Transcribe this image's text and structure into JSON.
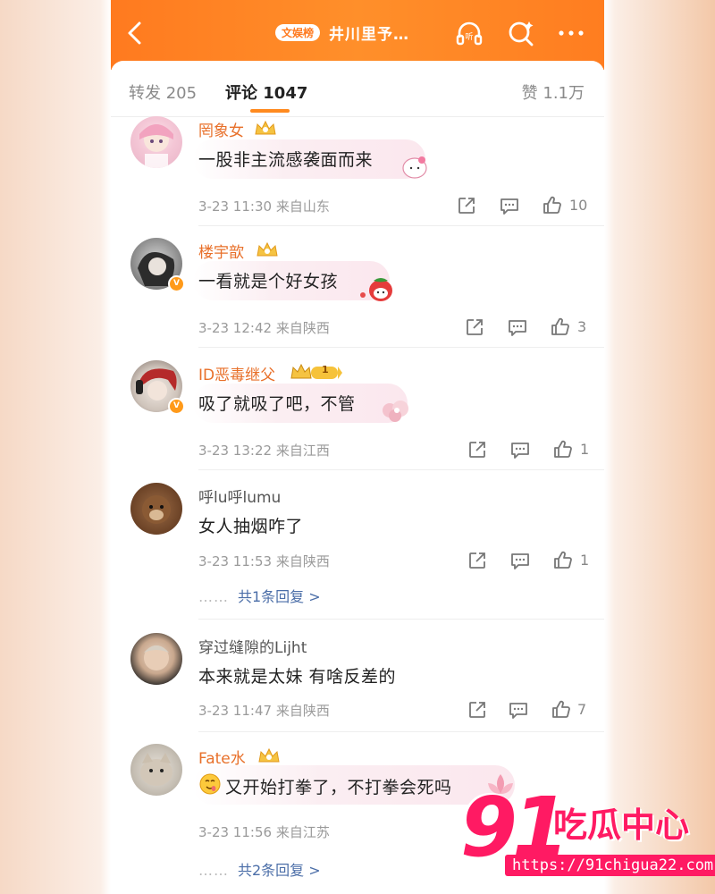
{
  "header": {
    "badge": "文娱榜",
    "title": "井川里予…",
    "accent": "#ff7a1f"
  },
  "tabs": {
    "repost": "转发 205",
    "comments": "评论 1047",
    "likes": "赞 1.1万"
  },
  "comments": [
    {
      "user": "罔象女",
      "text": "一股非主流感袭面而来",
      "time": "3-23 11:30",
      "location": "来自山东",
      "likes": "10",
      "vip": true
    },
    {
      "user": "楼宇歆",
      "text": "一看就是个好女孩",
      "time": "3-23 12:42",
      "location": "来自陕西",
      "likes": "3",
      "vip": true
    },
    {
      "user": "ID恶毒继父",
      "text": "吸了就吸了吧，不管",
      "time": "3-23 13:22",
      "location": "来自江西",
      "likes": "1",
      "vip": true,
      "level": "1"
    },
    {
      "user": "呼lu呼lumu",
      "text": "女人抽烟咋了",
      "time": "3-23 11:53",
      "location": "来自陕西",
      "likes": "1",
      "vip": false,
      "replies": "共1条回复 >"
    },
    {
      "user": "穿过缝隙的Lijht",
      "text": "本来就是太妹  有啥反差的",
      "time": "3-23 11:47",
      "location": "来自陕西",
      "likes": "7",
      "vip": false
    },
    {
      "user": "Fate水",
      "text": "又开始打拳了，不打拳会死吗",
      "time": "3-23 11:56",
      "location": "来自江苏",
      "likes": "",
      "vip": true,
      "replies": "共2条回复 >"
    }
  ],
  "reply_dots": "……",
  "watermark": {
    "number": "91",
    "name": "吃瓜中心",
    "url": "https://91chigua22.com"
  }
}
